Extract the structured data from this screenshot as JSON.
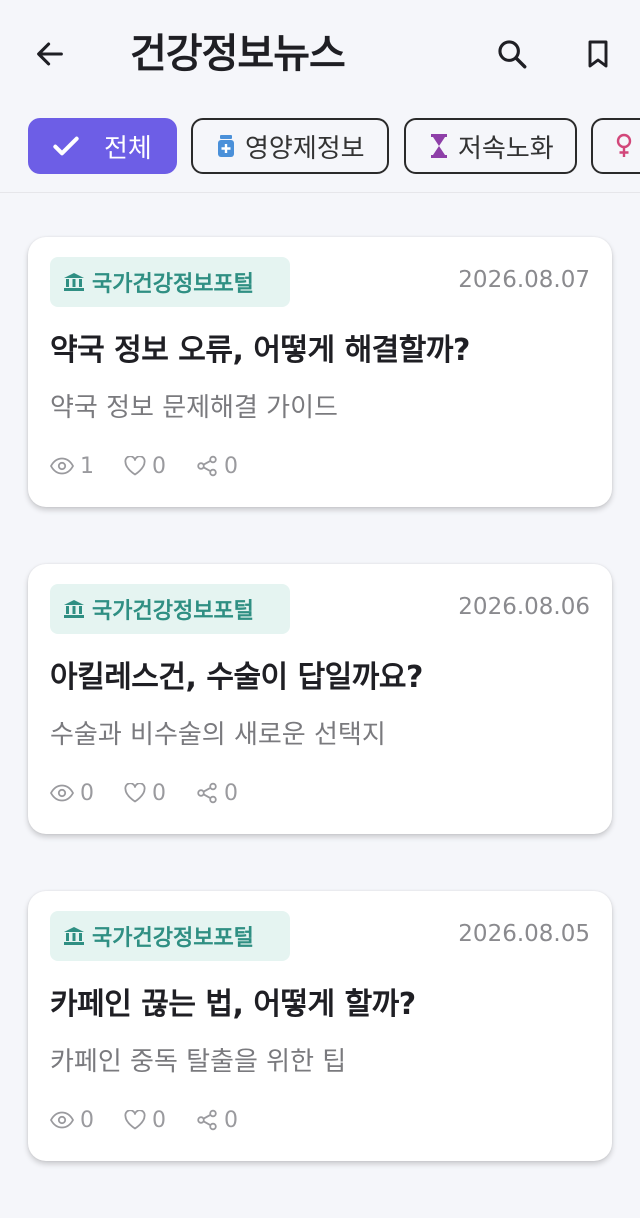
{
  "header": {
    "title": "건강정보뉴스"
  },
  "chips": [
    {
      "label": "전체"
    },
    {
      "label": "영양제정보"
    },
    {
      "label": "저속노화"
    },
    {
      "label": ""
    }
  ],
  "articles": [
    {
      "source": "국가건강정보포털",
      "date": "2026.08.07",
      "title": "약국 정보 오류, 어떻게 해결할까?",
      "subtitle": "약국 정보 문제해결 가이드",
      "views": "1",
      "likes": "0",
      "shares": "0"
    },
    {
      "source": "국가건강정보포털",
      "date": "2026.08.06",
      "title": "아킬레스건, 수술이 답일까요?",
      "subtitle": "수술과 비수술의 새로운 선택지",
      "views": "0",
      "likes": "0",
      "shares": "0"
    },
    {
      "source": "국가건강정보포털",
      "date": "2026.08.05",
      "title": "카페인 끊는 법, 어떻게 할까?",
      "subtitle": "카페인 중독 탈출을 위한 팁",
      "views": "0",
      "likes": "0",
      "shares": "0"
    }
  ],
  "colors": {
    "accent": "#6d5ee6",
    "badge_bg": "#e5f4f1",
    "badge_text": "#2f8f83",
    "background": "#f5f6fa"
  },
  "icons": {
    "back": "arrow-left-icon",
    "search": "search-icon",
    "bookmark": "bookmark-icon",
    "chip_all": "check-icon",
    "chip_supplement": "pill-bottle-icon",
    "chip_aging": "hourglass-icon",
    "chip_women": "female-icon",
    "badge": "institution-icon",
    "views": "eye-icon",
    "likes": "heart-icon",
    "shares": "share-icon"
  }
}
